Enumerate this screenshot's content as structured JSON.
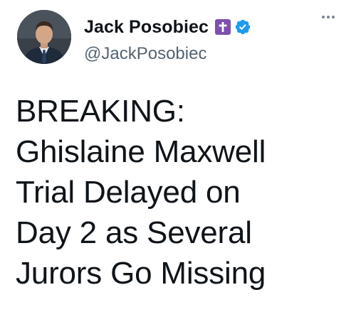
{
  "author": {
    "display_name": "Jack Posobiec",
    "handle": "@JackPosobiec",
    "avatar_icon": "profile-photo",
    "badge_icon": "cross-icon",
    "badge_color": "#7d4fb0",
    "verified_icon": "verified-badge-icon",
    "verified_color": "#1d9bf0"
  },
  "more_icon": "more-options-icon",
  "tweet": {
    "lines": [
      "BREAKING:",
      "Ghislaine Maxwell",
      "Trial Delayed on",
      "Day 2 as Several",
      "Jurors Go Missing"
    ]
  }
}
